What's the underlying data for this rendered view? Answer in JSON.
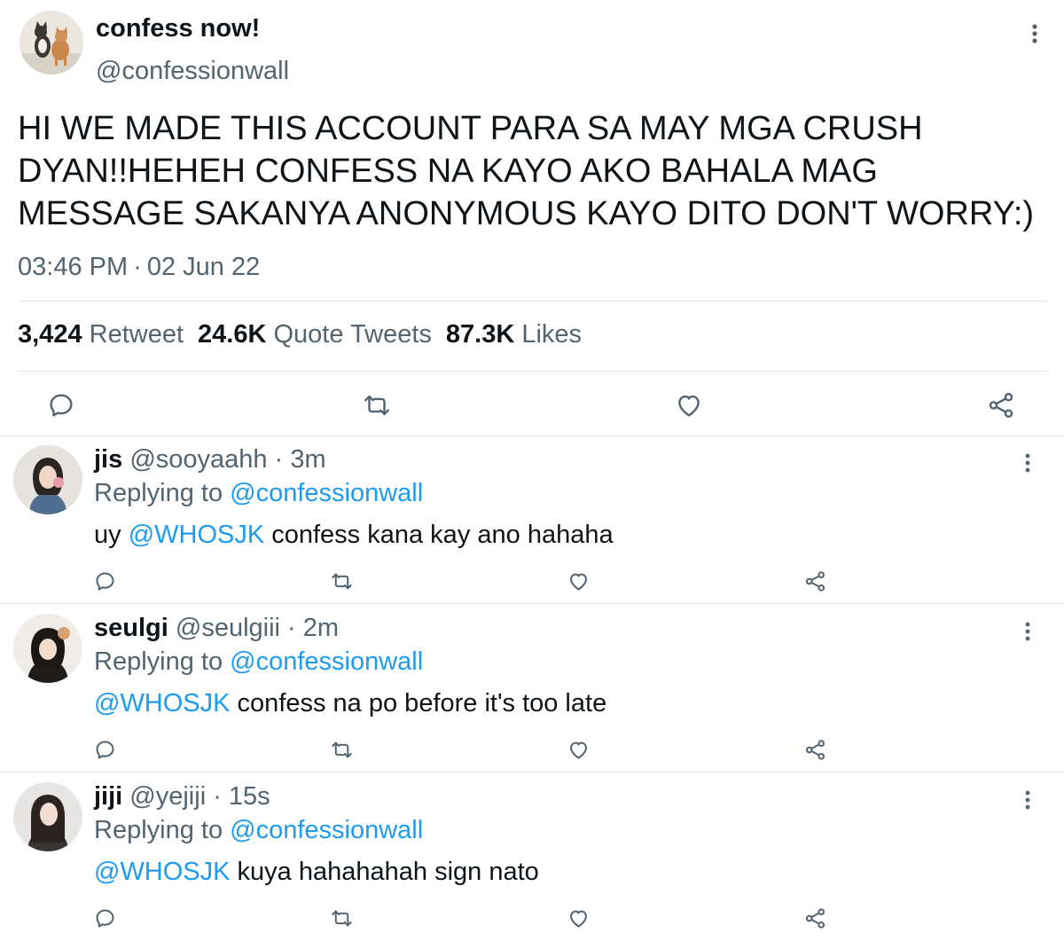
{
  "tweet": {
    "display_name": "confess now!",
    "handle": "@confessionwall",
    "text": "HI WE MADE THIS ACCOUNT PARA SA MAY MGA CRUSH DYAN!!HEHEH CONFESS NA KAYO AKO BAHALA MAG MESSAGE SAKANYA ANONYMOUS KAYO DITO DON'T WORRY:)",
    "time": "03:46 PM",
    "separator": "·",
    "date": "02 Jun 22",
    "stats": {
      "retweets": "3,424",
      "retweets_label": "Retweet",
      "quotes": "24.6K",
      "quotes_label": "Quote Tweets",
      "likes": "87.3K",
      "likes_label": "Likes"
    }
  },
  "replies": [
    {
      "name": "jis",
      "handle": "@sooyaahh",
      "time": "3m",
      "replying_label": "Replying to",
      "replying_to": "@confessionwall",
      "body_prefix": "uy ",
      "mention": "@WHOSJK",
      "body_suffix": " confess kana kay ano hahaha"
    },
    {
      "name": "seulgi",
      "handle": "@seulgiii",
      "time": "2m",
      "replying_label": "Replying to",
      "replying_to": "@confessionwall",
      "body_prefix": "",
      "mention": "@WHOSJK",
      "body_suffix": " confess na po before it's too late"
    },
    {
      "name": "jiji",
      "handle": "@yejiji",
      "time": "15s",
      "replying_label": "Replying to",
      "replying_to": "@confessionwall",
      "body_prefix": "",
      "mention": "@WHOSJK",
      "body_suffix": " kuya hahahahah sign nato"
    }
  ],
  "icons": [
    "more-vertical-icon",
    "reply-icon",
    "retweet-icon",
    "like-icon",
    "share-icon"
  ],
  "colors": {
    "text": "#0f1419",
    "secondary": "#536471",
    "link": "#1d9bf0",
    "divider": "#e3e6e8"
  }
}
